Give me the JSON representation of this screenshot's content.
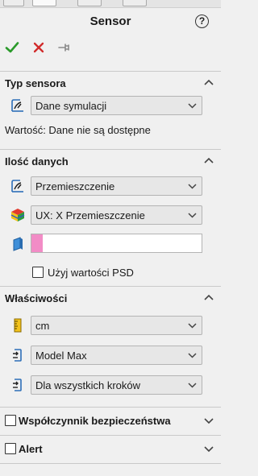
{
  "panel": {
    "title": "Sensor",
    "help_glyph": "?",
    "actions": [
      {
        "name": "ok",
        "icon": "green-check-icon",
        "color": "#2a9a2a"
      },
      {
        "name": "cancel",
        "icon": "red-x-icon",
        "color": "#d12a2a"
      },
      {
        "name": "pin",
        "icon": "pushpin-icon",
        "color": "#8a8a8a"
      }
    ]
  },
  "sensor_type": {
    "title": "Typ sensora",
    "dropdown_value": "Dane symulacji",
    "value_text": "Wartość: Dane nie są dostępne",
    "icon": "sensor-gauge-icon"
  },
  "data_quantity": {
    "title": "Ilość danych",
    "quantity_dropdown": "Przemieszczenie",
    "component_dropdown": "UX: X Przemieszczenie",
    "selection_color": "#f28cc6",
    "psd_label": "Użyj wartości PSD",
    "icons": [
      "sensor-gauge-icon",
      "result-cube-icon",
      "face-selection-icon"
    ]
  },
  "properties": {
    "title": "Właściwości",
    "unit_dropdown": "cm",
    "criterion_dropdown": "Model Max",
    "steps_dropdown": "Dla wszystkich kroków",
    "icons": [
      "ruler-icon",
      "criterion-icon",
      "step-criterion-icon"
    ]
  },
  "safety_factor": {
    "title": "Współczynnik bezpieczeństwa"
  },
  "alert": {
    "title": "Alert"
  }
}
